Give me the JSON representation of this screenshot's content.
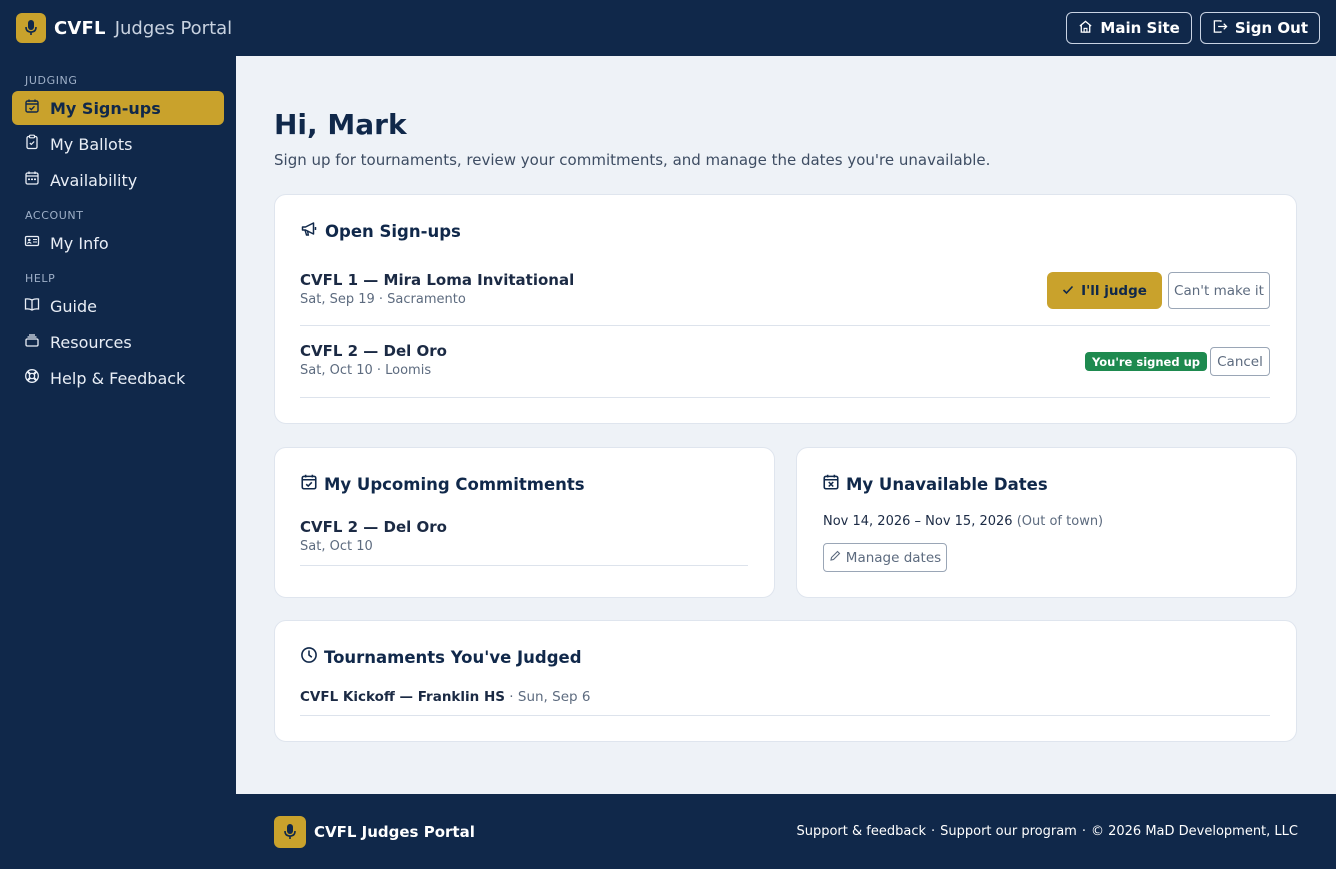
{
  "header": {
    "brand_bold": "CVFL",
    "brand_sub": "Judges Portal",
    "main_site_label": "Main Site",
    "sign_out_label": "Sign Out"
  },
  "sidebar": {
    "sections": [
      {
        "title": "JUDGING",
        "items": [
          {
            "label": "My Sign-ups",
            "icon": "calendar-check-icon",
            "active": true
          },
          {
            "label": "My Ballots",
            "icon": "clipboard-icon"
          },
          {
            "label": "Availability",
            "icon": "calendar-range-icon"
          }
        ]
      },
      {
        "title": "ACCOUNT",
        "items": [
          {
            "label": "My Info",
            "icon": "id-card-icon"
          }
        ]
      },
      {
        "title": "HELP",
        "items": [
          {
            "label": "Guide",
            "icon": "book-icon"
          },
          {
            "label": "Resources",
            "icon": "stack-icon"
          },
          {
            "label": "Help & Feedback",
            "icon": "lifebuoy-icon"
          }
        ]
      }
    ]
  },
  "main": {
    "greeting": "Hi, Mark",
    "intro": "Sign up for tournaments, review your commitments, and manage the dates you're unavailable."
  },
  "open_signups": {
    "title": "Open Sign-ups",
    "rows": [
      {
        "name": "CVFL 1 — Mira Loma Invitational",
        "meta": "Sat, Sep 19 · Sacramento",
        "primary_label": "I'll judge",
        "secondary_label": "Can't make it"
      },
      {
        "name": "CVFL 2 — Del Oro",
        "meta": "Sat, Oct 10 · Loomis",
        "badge": "You're signed up",
        "secondary_label": "Cancel"
      }
    ]
  },
  "commitments": {
    "title": "My Upcoming Commitments",
    "items": [
      {
        "name": "CVFL 2 — Del Oro",
        "meta": "Sat, Oct 10"
      }
    ]
  },
  "unavailable": {
    "title": "My Unavailable Dates",
    "range": "Nov 14, 2026 – Nov 15, 2026",
    "reason": "(Out of town)",
    "manage_label": "Manage dates"
  },
  "judged": {
    "title": "Tournaments You've Judged",
    "items": [
      {
        "name": "CVFL Kickoff — Franklin HS",
        "meta": "· Sun, Sep 6"
      }
    ]
  },
  "footer": {
    "brand": "CVFL Judges Portal",
    "support_link": "Support & feedback",
    "program_link": "Support our program",
    "copyright": "© 2026 MaD Development, LLC"
  },
  "colors": {
    "navy": "#10284a",
    "gold": "#c9a22c",
    "success": "#1e8a4f",
    "background": "#eef2f7"
  }
}
